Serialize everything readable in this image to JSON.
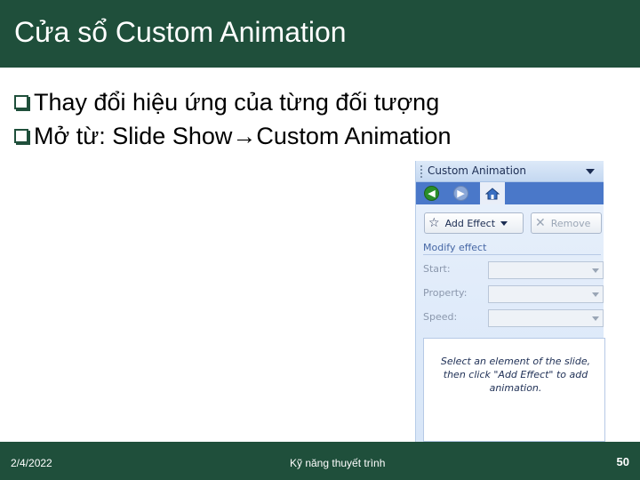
{
  "slide": {
    "title": "Cửa sổ Custom Animation",
    "bullets": [
      {
        "text": "Thay đổi hiệu ứng của từng đối tượng"
      },
      {
        "text_before": "Mở từ: Slide Show",
        "arrow": "→",
        "text_after": "Custom Animation"
      }
    ]
  },
  "panel": {
    "title": "Custom Animation",
    "icons": {
      "back": "back-arrow-icon",
      "forward": "forward-arrow-icon",
      "home": "home-icon",
      "dropdown": "chevron-down-icon"
    },
    "add_effect_label": "Add Effect",
    "remove_label": "Remove",
    "modify_effect_label": "Modify effect",
    "fields": [
      {
        "label": "Start:",
        "value": ""
      },
      {
        "label": "Property:",
        "value": ""
      },
      {
        "label": "Speed:",
        "value": ""
      }
    ],
    "help_text": "Select an element of the slide, then click \"Add Effect\" to add animation."
  },
  "footer": {
    "date": "2/4/2022",
    "title": "Kỹ năng thuyết trình",
    "page_number": "50"
  },
  "colors": {
    "theme_green": "#1f4f3b",
    "panel_header": "#c4d8f1",
    "panel_nav": "#4a78c9",
    "panel_body": "#dce8f8"
  }
}
